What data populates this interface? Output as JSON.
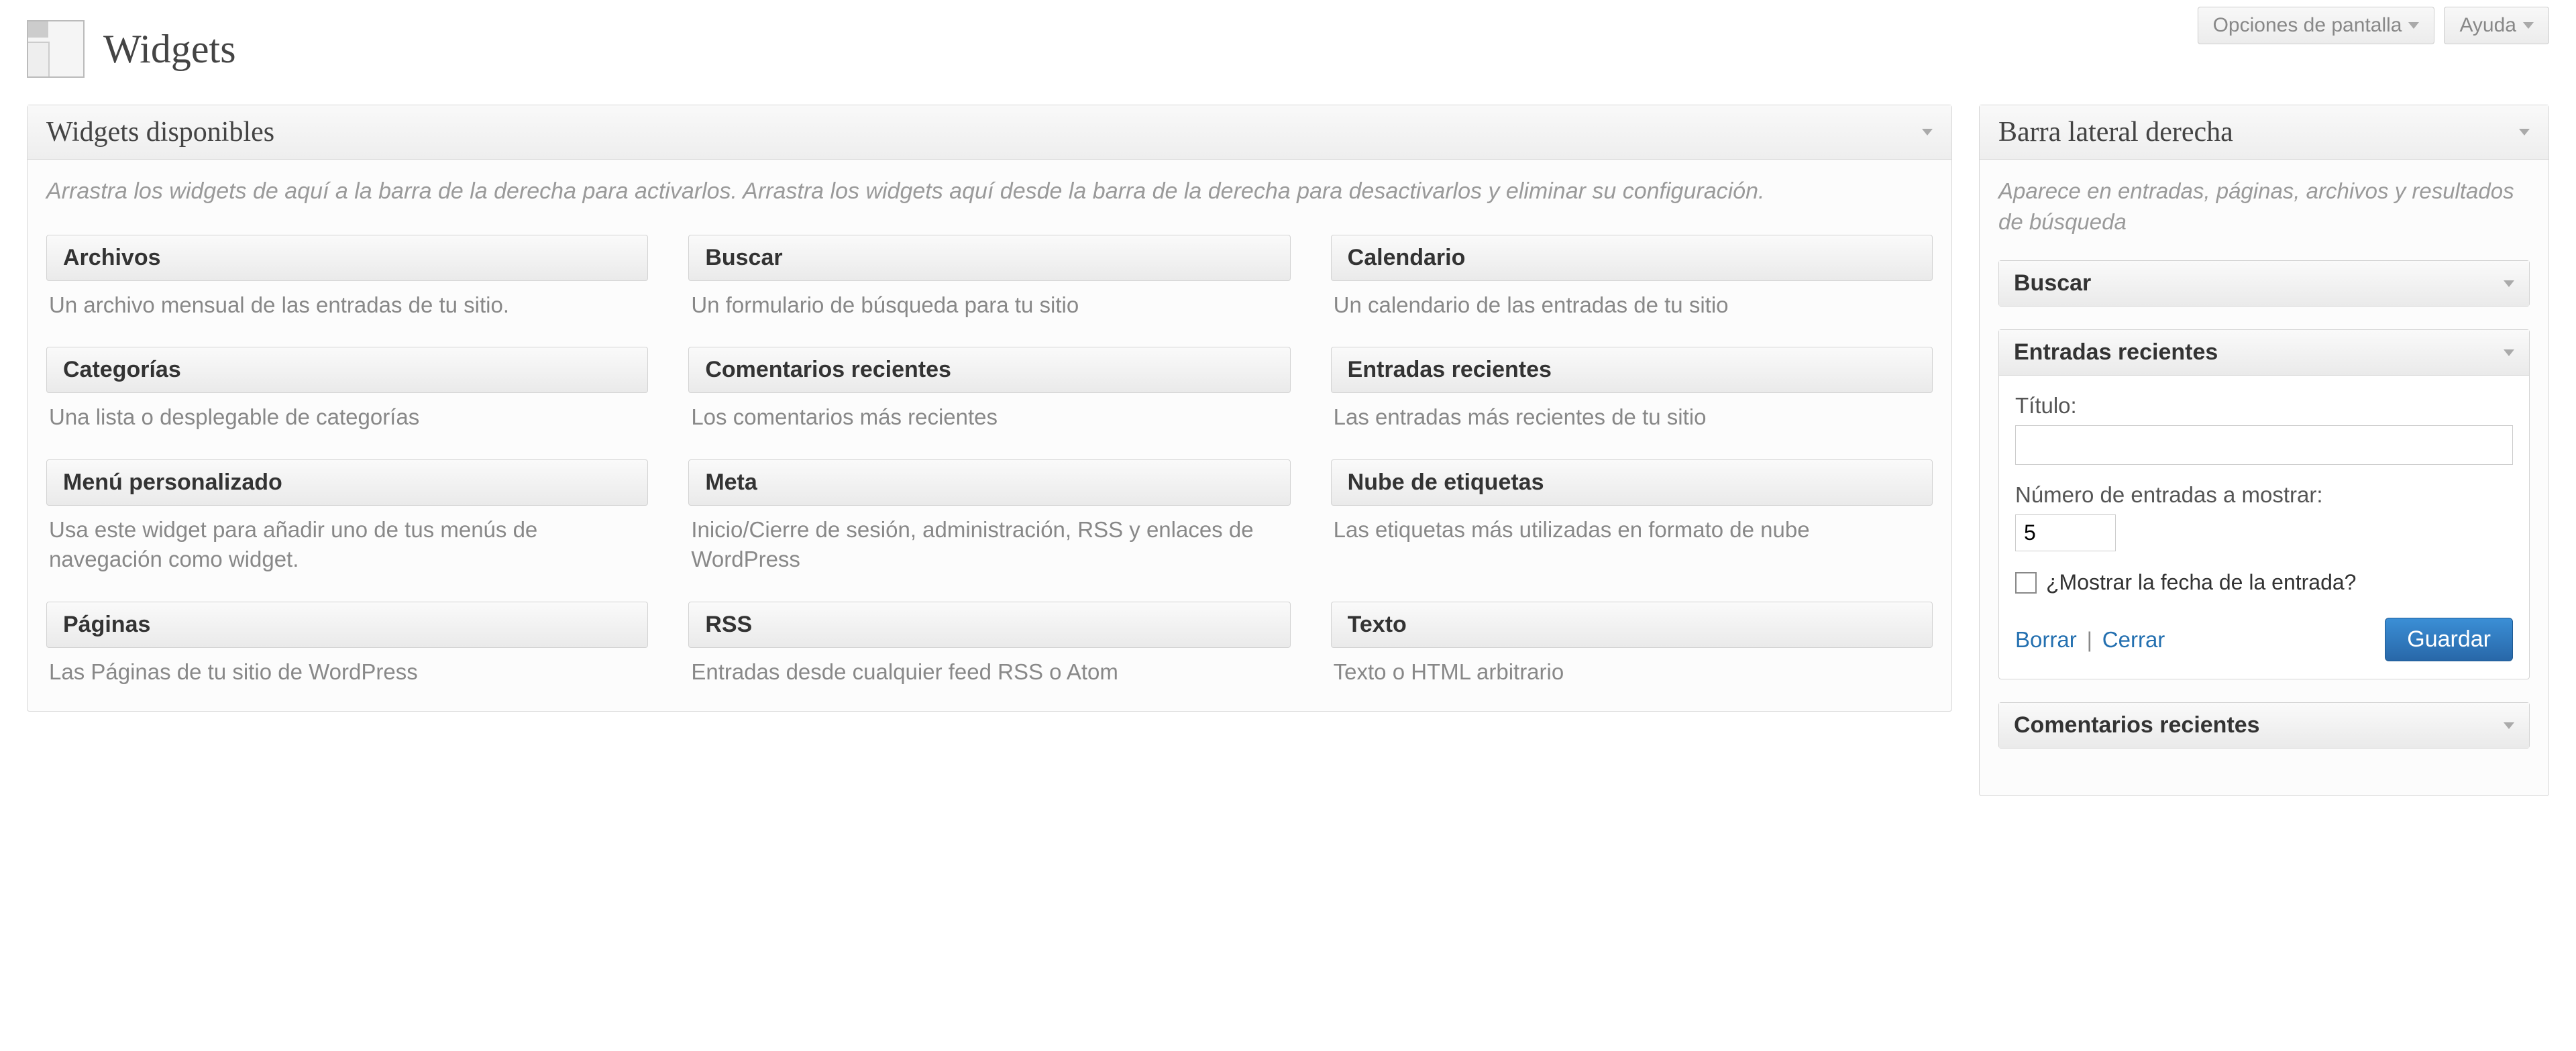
{
  "topButtons": {
    "screenOptions": "Opciones de pantalla",
    "help": "Ayuda"
  },
  "pageTitle": "Widgets",
  "availablePanel": {
    "title": "Widgets disponibles",
    "instruction": "Arrastra los widgets de aquí a la barra de la derecha para activarlos. Arrastra los widgets aquí desde la barra de la derecha para desactivarlos y eliminar su configuración."
  },
  "widgets": [
    {
      "name": "Archivos",
      "desc": "Un archivo mensual de las entradas de tu sitio."
    },
    {
      "name": "Buscar",
      "desc": "Un formulario de búsqueda para tu sitio"
    },
    {
      "name": "Calendario",
      "desc": "Un calendario de las entradas de tu sitio"
    },
    {
      "name": "Categorías",
      "desc": "Una lista o desplegable de categorías"
    },
    {
      "name": "Comentarios recientes",
      "desc": "Los comentarios más recientes"
    },
    {
      "name": "Entradas recientes",
      "desc": "Las entradas más recientes de tu sitio"
    },
    {
      "name": "Menú personalizado",
      "desc": "Usa este widget para añadir uno de tus menús de navegación como widget."
    },
    {
      "name": "Meta",
      "desc": "Inicio/Cierre de sesión, administración, RSS y enlaces de WordPress"
    },
    {
      "name": "Nube de etiquetas",
      "desc": "Las etiquetas más utilizadas en formato de nube"
    },
    {
      "name": "Páginas",
      "desc": "Las Páginas de tu sitio de WordPress"
    },
    {
      "name": "RSS",
      "desc": "Entradas desde cualquier feed RSS o Atom"
    },
    {
      "name": "Texto",
      "desc": "Texto o HTML arbitrario"
    }
  ],
  "sidebar": {
    "title": "Barra lateral derecha",
    "desc": "Aparece en entradas, páginas, archivos y resultados de búsqueda",
    "items": {
      "buscar": {
        "title": "Buscar"
      },
      "recientes": {
        "title": "Entradas recientes",
        "labelTitulo": "Título:",
        "valueTitulo": "",
        "labelNumero": "Número de entradas a mostrar:",
        "valueNumero": "5",
        "labelFecha": "¿Mostrar la fecha de la entrada?",
        "linkBorrar": "Borrar",
        "linkCerrar": "Cerrar",
        "btnGuardar": "Guardar"
      },
      "comentarios": {
        "title": "Comentarios recientes"
      }
    }
  }
}
